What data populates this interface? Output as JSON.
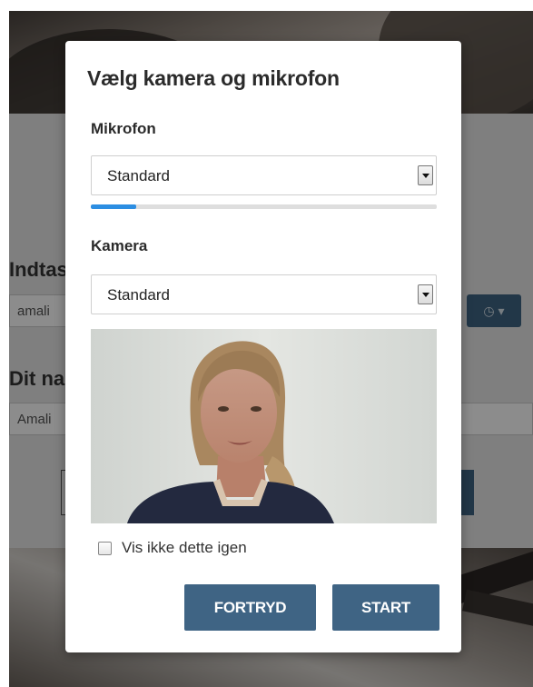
{
  "background": {
    "label_1": "Indtas",
    "label_2": "Dit na",
    "input_1_value": "amali",
    "input_2_value": "Amali",
    "history_button_label": "◷ ▾"
  },
  "modal": {
    "title": "Vælg kamera og mikrofon",
    "microphone": {
      "label": "Mikrofon",
      "selected": "Standard",
      "level": 0.13
    },
    "camera": {
      "label": "Kamera",
      "selected": "Standard"
    },
    "preview_icon": "camera-preview-image",
    "dont_show_again": {
      "label": "Vis ikke dette igen",
      "checked": false
    },
    "buttons": {
      "cancel": "FORTRYD",
      "start": "START"
    }
  },
  "colors": {
    "primary_button": "#3f6484",
    "level_meter": "#2c8ee2"
  }
}
